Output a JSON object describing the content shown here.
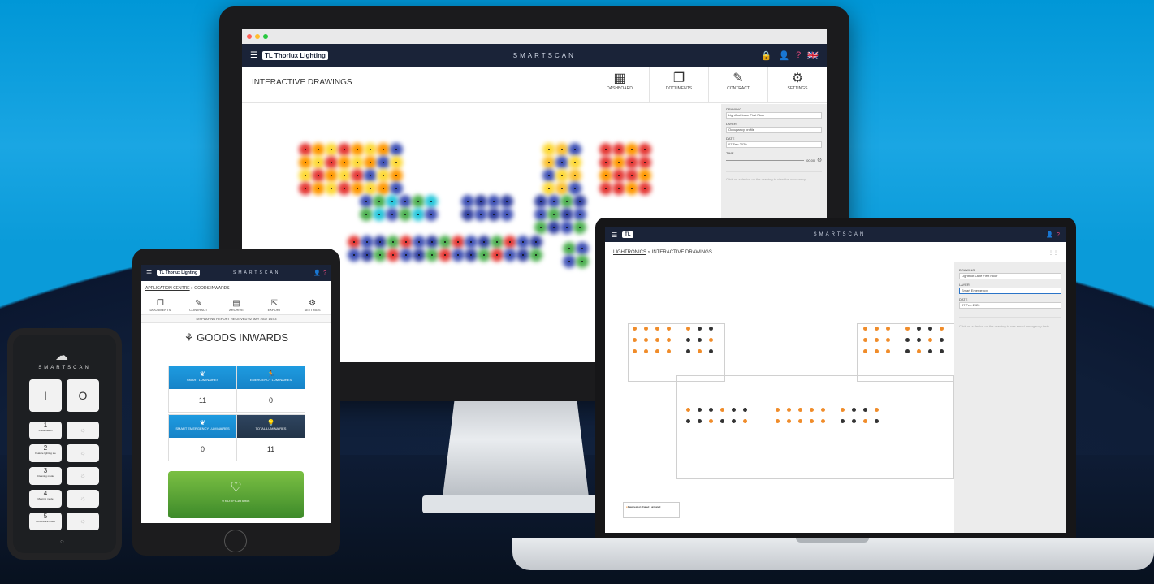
{
  "desktop": {
    "brand": "SMARTSCAN",
    "logo": "TL Thorlux Lighting",
    "page_title": "INTERACTIVE DRAWINGS",
    "tabs": [
      {
        "label": "DASHBOARD",
        "icon": "dashboard-icon"
      },
      {
        "label": "DOCUMENTS",
        "icon": "documents-icon"
      },
      {
        "label": "CONTRACT",
        "icon": "contract-icon"
      },
      {
        "label": "SETTINGS",
        "icon": "gear-icon"
      }
    ],
    "side": {
      "drawing_label": "DRAWING",
      "drawing_value": "Lightfoot Lane First Floor",
      "layer_label": "LAYER",
      "layer_value": "Occupancy profile",
      "date_label": "DATE",
      "date_value": "07 Feb 2020",
      "time_label": "TIME",
      "time_value": "00:00",
      "hint": "Click on a device on the drawing to view the occupancy"
    }
  },
  "laptop": {
    "brand": "SMARTSCAN",
    "crumb_link": "LIGHTRONICS",
    "crumb_sep": "»",
    "crumb_page": "INTERACTIVE DRAWINGS",
    "side": {
      "drawing_label": "DRAWING",
      "drawing_value": "Lightfoot Lane First Floor",
      "layer_label": "LAYER",
      "layer_value": "Smart Emergency",
      "date_label": "DATE",
      "date_value": "07 Feb 2020",
      "hint": "Click on a device on the drawing to see smart emergency tests"
    },
    "legend": [
      "Pass tested",
      "Failed / untested"
    ]
  },
  "tablet": {
    "logo": "TL Thorlux Lighting",
    "brand": "SMARTSCAN",
    "crumb_link": "APPLICATION CENTRE",
    "crumb_sep": "»",
    "crumb_page": "GOODS INWARDS",
    "tabs": [
      "DOCUMENTS",
      "CONTRACT",
      "ARCHIVE",
      "EXPORT",
      "SETTINGS"
    ],
    "report": "DISPLAYING REPORT RECEIVED 02 MAY 2017 14:53",
    "section_title": "GOODS INWARDS",
    "cards": [
      {
        "label": "SMART LUMINAIRES",
        "value": "11"
      },
      {
        "label": "EMERGENCY LUMINAIRES",
        "value": "0"
      },
      {
        "label": "SMART EMERGENCY LUMINAIRES",
        "value": "0"
      },
      {
        "label": "TOTAL LUMINAIRES",
        "value": "11"
      }
    ],
    "notifications": "0 NOTIFICATIONS"
  },
  "phone": {
    "brand": "SMARTSCAN",
    "power_on": "I",
    "power_off": "O",
    "scenes": [
      {
        "num": "1",
        "label": "Presentation"
      },
      {
        "num": "2",
        "label": "Feature lighting ste"
      },
      {
        "num": "3",
        "label": "Cleaning mode"
      },
      {
        "num": "4",
        "label": "Meeting mode"
      },
      {
        "num": "5",
        "label": "Conference mode"
      }
    ]
  }
}
